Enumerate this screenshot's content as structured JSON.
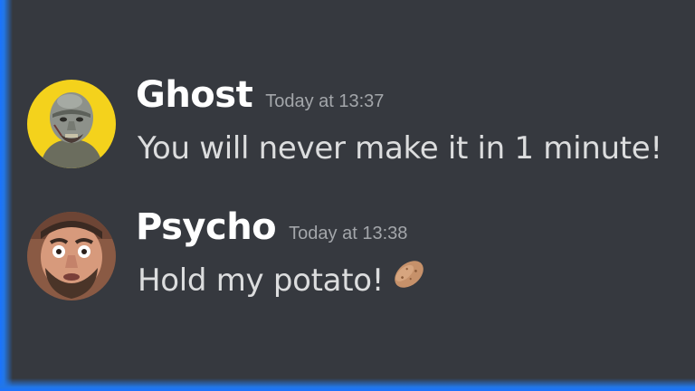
{
  "messages": [
    {
      "username": "Ghost",
      "timestamp": "Today at 13:37",
      "text": "You will never make it in 1 minute!",
      "avatar": "ghost-avatar"
    },
    {
      "username": "Psycho",
      "timestamp": "Today at 13:38",
      "text": "Hold my potato!",
      "avatar": "psycho-avatar",
      "emoji": "potato-icon"
    }
  ],
  "colors": {
    "background": "#36393f",
    "username": "#ffffff",
    "timestamp": "#a3a6aa",
    "text": "#dcddde",
    "edge_glow": "#1a73ff"
  }
}
